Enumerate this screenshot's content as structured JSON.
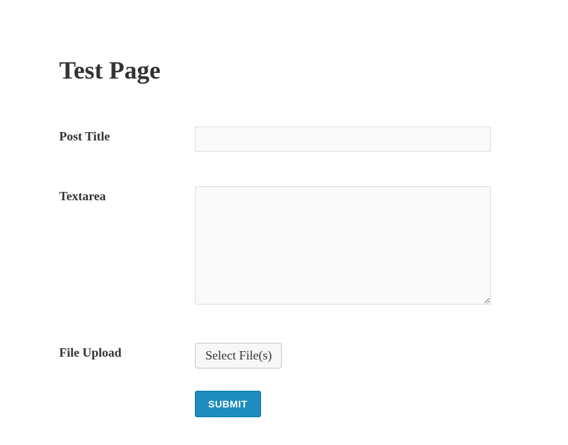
{
  "page": {
    "title": "Test Page"
  },
  "form": {
    "fields": {
      "post_title": {
        "label": "Post Title",
        "value": ""
      },
      "textarea": {
        "label": "Textarea",
        "value": ""
      },
      "file_upload": {
        "label": "File Upload",
        "button_label": "Select File(s)"
      }
    },
    "submit_label": "SUBMIT"
  }
}
